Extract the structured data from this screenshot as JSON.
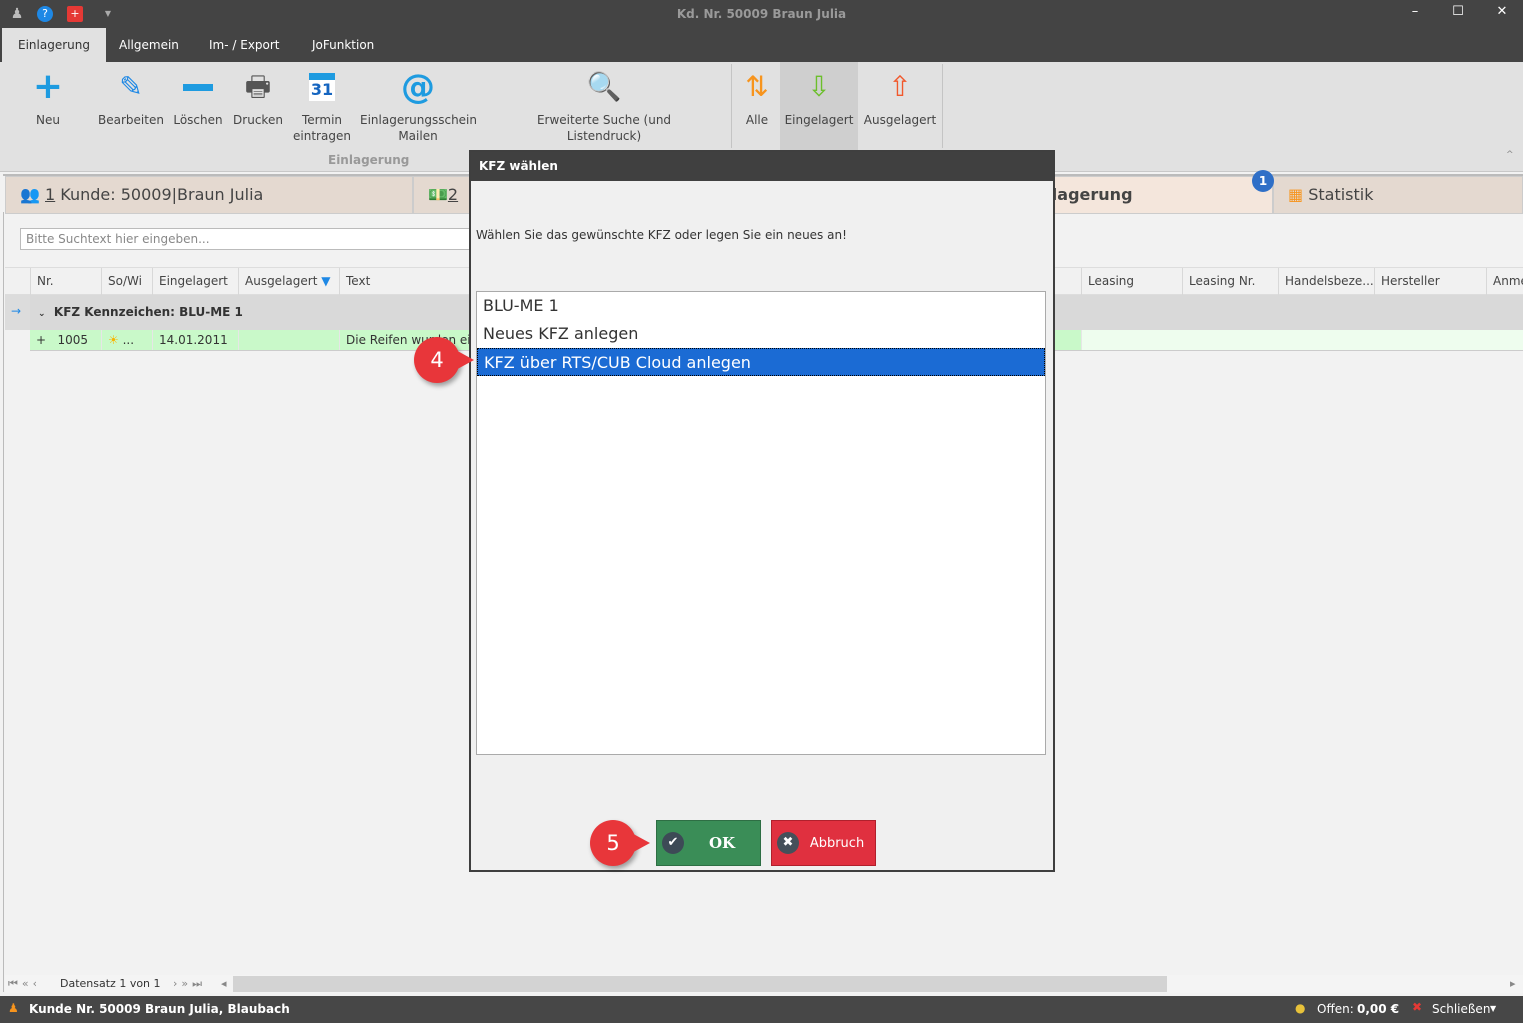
{
  "window": {
    "title": "Kd. Nr. 50009 Braun Julia",
    "icons": [
      "users-icon",
      "help-icon",
      "swiss-flag-icon"
    ],
    "minimize": "–",
    "maximize": "☐",
    "close": "✕"
  },
  "ribbon_tabs": [
    "Einlagerung",
    "Allgemein",
    "Im- / Export",
    "JoFunktion"
  ],
  "ribbon": {
    "buttons": [
      {
        "label": "Neu",
        "icon": "add-icon"
      },
      {
        "label": "Bearbeiten",
        "icon": "pencil-icon"
      },
      {
        "label": "Löschen",
        "icon": "minus-icon"
      },
      {
        "label": "Drucken",
        "icon": "printer-icon"
      },
      {
        "label": "Termin eintragen",
        "icon": "calendar-icon",
        "icon_text": "31"
      },
      {
        "label": "Einlagerungsschein Mailen",
        "icon": "at-icon"
      },
      {
        "label": "Erweiterte Suche (und Listendruck)",
        "icon": "magnifier-icon"
      }
    ],
    "group_label": "Einlagerung",
    "filters": [
      {
        "label": "Alle"
      },
      {
        "label": "Eingelagert",
        "selected": true
      },
      {
        "label": "Ausgelagert"
      }
    ]
  },
  "doc_tabs": {
    "tab1_num": "1",
    "tab1": "Kunde: 50009|Braun Julia",
    "tab2_num": "2",
    "tab3": "Einlagerung",
    "tab4": "Statistik",
    "notification_count": "1"
  },
  "search": {
    "placeholder": "Bitte Suchtext hier eingeben..."
  },
  "grid": {
    "columns_left": [
      "Nr.",
      "So/Wi",
      "Eingelagert",
      "Ausgelagert",
      "Text"
    ],
    "columns_right": [
      "Leasing",
      "Leasing Nr.",
      "Handelsbeze...",
      "Hersteller",
      "Anme"
    ],
    "group": "KFZ Kennzeichen: BLU-ME 1",
    "row": {
      "expand": "+",
      "nr": "1005",
      "sowi": "...",
      "eingelagert": "14.01.2011",
      "ausgelagert": "",
      "text": "Die Reifen wurden ein"
    }
  },
  "navigator": {
    "text": "Datensatz 1 von 1"
  },
  "status": {
    "customer": "Kunde Nr. 50009 Braun Julia, Blaubach",
    "offen_label": "Offen:",
    "offen_value": "0,00 €",
    "close": "Schließen"
  },
  "dialog": {
    "title": "KFZ wählen",
    "message": "Wählen Sie das gewünschte KFZ oder legen Sie ein neues an!",
    "items": [
      "BLU-ME 1",
      "Neues KFZ anlegen",
      "KFZ über RTS/CUB Cloud anlegen"
    ],
    "selected_index": 2,
    "ok": "OK",
    "cancel": "Abbruch"
  },
  "callouts": [
    "4",
    "5"
  ],
  "colors": {
    "ok": "#3a8d57",
    "cancel": "#e0303f",
    "selection": "#1b6bd4",
    "callout": "#e8363a",
    "row_green": "#c9f9c9"
  }
}
